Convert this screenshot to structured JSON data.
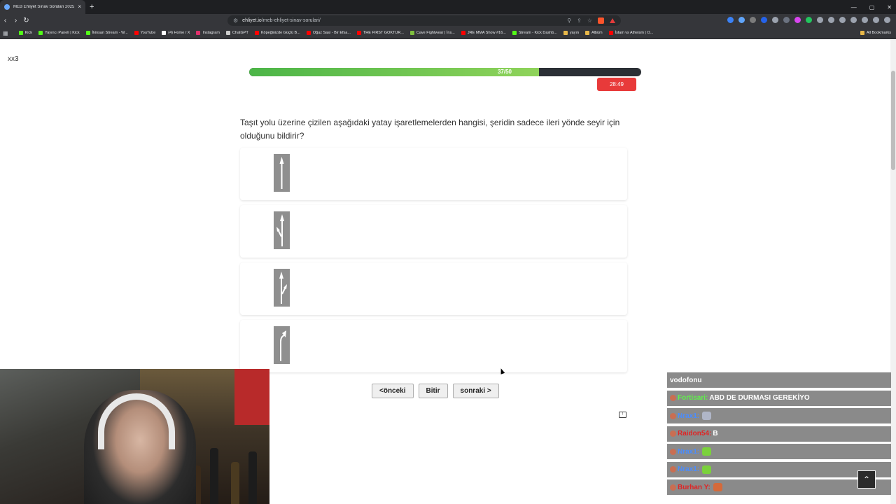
{
  "browser": {
    "tab_title": "MEB Ehliyet Sınav Soruları 2025",
    "tab_close": "×",
    "new_tab": "+",
    "url_host": "ehliyet.io",
    "url_path": "/meb-ehliyet-sinav-sorulari/",
    "window_controls": [
      "—",
      "▢",
      "✕"
    ],
    "bookmarks": [
      {
        "label": "Kick",
        "color": "#53fc18"
      },
      {
        "label": "Yayıncı Paneli | Kick",
        "color": "#53fc18"
      },
      {
        "label": "İkinsan Stream - W...",
        "color": "#53fc18"
      },
      {
        "label": "YouTube",
        "color": "#ff0000"
      },
      {
        "label": "(4) Home / X",
        "color": "#ffffff"
      },
      {
        "label": "Instagram",
        "color": "#e1306c"
      },
      {
        "label": "ChatGPT",
        "color": "#cccccc"
      },
      {
        "label": "Köpeğinizde Güçlü B...",
        "color": "#ff0000"
      },
      {
        "label": "Oğuz Sasi - Bir Efsa...",
        "color": "#ff0000"
      },
      {
        "label": "THE FIRST GOKTUR...",
        "color": "#ff0000"
      },
      {
        "label": "Cave Fightwear | İns...",
        "color": "#7fbf3f"
      },
      {
        "label": "JRE MMA Show #16...",
        "color": "#ff0000"
      },
      {
        "label": "Stream - Kick Dashb...",
        "color": "#53fc18"
      },
      {
        "label": "yayın",
        "color": "#e8b84a"
      },
      {
        "label": "Albüm",
        "color": "#e8b84a"
      },
      {
        "label": "İslam vs Atheism | O...",
        "color": "#ff0000"
      }
    ],
    "all_bookmarks": "All Bookmarks"
  },
  "page": {
    "user_tag": "xx3",
    "progress_label": "37/50",
    "progress_fraction": 0.74,
    "timer": "28:49",
    "question": "Taşıt yolu üzerine çizilen aşağıdaki yatay işaretlemelerden hangisi, şeridin sadece ileri yönde seyir için olduğunu bildirir?",
    "options": [
      {
        "icon": "straight-arrow-marking"
      },
      {
        "icon": "straight-or-left-arrow-marking"
      },
      {
        "icon": "straight-or-right-arrow-marking"
      },
      {
        "icon": "right-turn-arrow-marking"
      }
    ],
    "buttons": {
      "prev": "<önceki",
      "finish": "Bitir",
      "next": "sonraki >"
    },
    "back_to_top": "⌃"
  },
  "chat": {
    "messages": [
      {
        "user": "",
        "text": "vodofonu",
        "user_color": "#ffffff"
      },
      {
        "user": "Fortisari:",
        "text": "ABD DE DURMASI GEREKİYO",
        "user_color": "#5ff24a"
      },
      {
        "user": "Nrax1:",
        "text": "",
        "user_color": "#4a8cff",
        "emote_color": "#b0b6c8"
      },
      {
        "user": "Raidon54:",
        "text": "B",
        "user_color": "#e02424"
      },
      {
        "user": "Nrax1:",
        "text": "",
        "user_color": "#4a8cff",
        "emote_color": "#7bd13c"
      },
      {
        "user": "Nrax1:",
        "text": "",
        "user_color": "#4a8cff",
        "emote_color": "#7bd13c"
      },
      {
        "user": "Burhan Y:",
        "text": "",
        "user_color": "#e02424",
        "emote_color": "#d46a3a"
      }
    ]
  }
}
